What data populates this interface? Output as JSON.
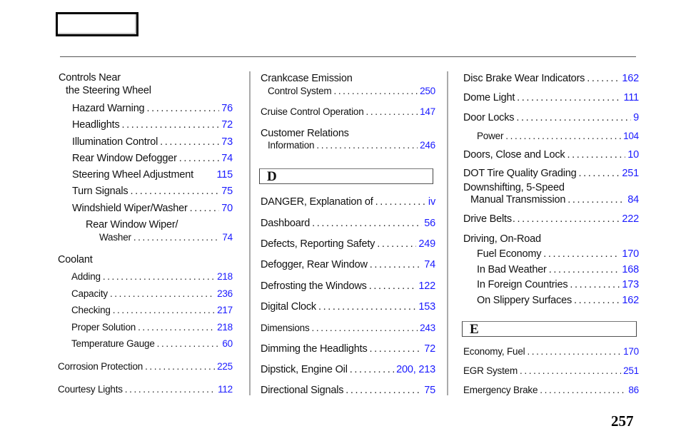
{
  "page": {
    "number": "257",
    "link_color": "#1a1aff"
  },
  "col1": {
    "group1_title_1": "Controls Near",
    "group1_title_2": "the Steering Wheel",
    "entries": [
      {
        "label": "Hazard Warning",
        "page": "76"
      },
      {
        "label": "Headlights",
        "page": "72"
      },
      {
        "label": "Illumination Control",
        "page": "73"
      },
      {
        "label": "Rear Window Defogger",
        "page": "74"
      },
      {
        "label": "Steering Wheel Adjustment",
        "page": "115"
      },
      {
        "label": "Turn Signals",
        "page": "75"
      },
      {
        "label": "Windshield Wiper/Washer",
        "page": "70"
      }
    ],
    "sub_title": "Rear Window Wiper/",
    "sub_entry": {
      "label": "Washer",
      "page": "74"
    },
    "group2_title": "Coolant",
    "coolant": [
      {
        "label": "Adding",
        "page": "218"
      },
      {
        "label": "Capacity",
        "page": "236"
      },
      {
        "label": "Checking",
        "page": "217"
      },
      {
        "label": "Proper Solution",
        "page": "218"
      },
      {
        "label": "Temperature Gauge",
        "page": "60"
      }
    ],
    "tail": [
      {
        "label": "Corrosion Protection",
        "page": "225"
      },
      {
        "label": "Courtesy Lights",
        "page": "112"
      }
    ]
  },
  "col2": {
    "crankcase_title": "Crankcase  Emission",
    "crankcase": {
      "label": "Control System",
      "page": "250"
    },
    "cruise": {
      "label": "Cruise Control Operation",
      "page": "147"
    },
    "customer_title": "Customer  Relations",
    "customer": {
      "label": "Information",
      "page": "246"
    },
    "section_letter": "D",
    "entries": [
      {
        "label": "DANGER, Explanation of",
        "page": "iv"
      },
      {
        "label": "Dashboard",
        "page": "56"
      },
      {
        "label": "Defects, Reporting Safety",
        "page": "249"
      },
      {
        "label": "Defogger, Rear Window",
        "page": "74"
      },
      {
        "label": "Defrosting the Windows",
        "page": "122"
      },
      {
        "label": "Digital Clock",
        "page": "153"
      },
      {
        "label": "Dimensions",
        "page": "243"
      },
      {
        "label": "Dimming the Headlights",
        "page": "72"
      },
      {
        "label": "Dipstick, Engine Oil",
        "page": "200, 213"
      },
      {
        "label": "Directional Signals",
        "page": "75"
      }
    ]
  },
  "col3": {
    "entries": [
      {
        "label": "Disc Brake Wear Indicators",
        "page": "162"
      },
      {
        "label": "Dome Light",
        "page": "111"
      },
      {
        "label": "Door Locks",
        "page": "9"
      },
      {
        "label": "Power",
        "page": "104"
      },
      {
        "label": "Doors, Close and Lock",
        "page": "10"
      },
      {
        "label": "DOT Tire Quality Grading",
        "page": "251"
      }
    ],
    "downshift_title": "Downshifting, 5-Speed",
    "downshift": {
      "label": "Manual Transmission",
      "page": "84"
    },
    "drive_belts": {
      "label": "Drive Belts",
      "page": "222"
    },
    "driving_title": "Driving, On-Road",
    "driving": [
      {
        "label": "Fuel Economy",
        "page": "170"
      },
      {
        "label": "In Bad Weather",
        "page": "168"
      },
      {
        "label": "In Foreign Countries",
        "page": "173"
      },
      {
        "label": "On Slippery Surfaces",
        "page": "162"
      }
    ],
    "section_letter": "E",
    "e_entries": [
      {
        "label": "Economy, Fuel",
        "page": "170"
      },
      {
        "label": "EGR System",
        "page": "251"
      },
      {
        "label": "Emergency Brake",
        "page": "86"
      }
    ]
  }
}
